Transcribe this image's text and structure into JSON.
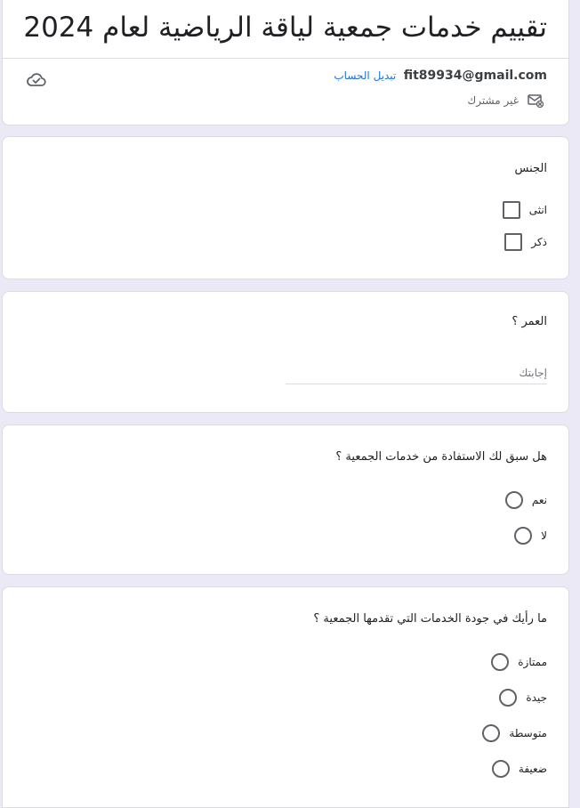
{
  "header": {
    "title": "تقييم خدمات جمعية لياقة الرياضية لعام 2024",
    "account_email": "fit89934@gmail.com",
    "switch_account": "تبديل الحساب",
    "not_shared": "غير مشترك"
  },
  "gender": {
    "title": "الجنس",
    "options": [
      "انثى",
      "ذكر"
    ]
  },
  "age": {
    "title": "العمر ؟",
    "placeholder": "إجابتك"
  },
  "benefit": {
    "title": "هل سبق لك الاستفادة من خدمات الجمعية ؟",
    "options": [
      "نعم",
      "لا"
    ]
  },
  "quality": {
    "title": "ما رأيك في جودة الخدمات التي تقدمها الجمعية ؟",
    "options": [
      "ممتازة",
      "جيدة",
      "متوسطة",
      "ضعيفة"
    ]
  },
  "colors": {
    "background": "#ece9f7",
    "link": "#1a73e8",
    "border": "#dadce0"
  },
  "icons": {
    "cloud": "cloud-check-icon",
    "not_shared": "mail-off-icon"
  }
}
